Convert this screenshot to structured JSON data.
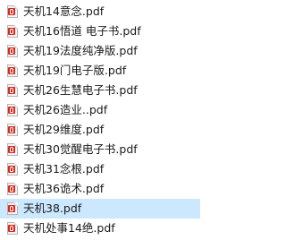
{
  "colors": {
    "selection": "#cce8ff",
    "pdf_badge": "#d42a1e",
    "text": "#1a1a1a"
  },
  "files": [
    {
      "name": "天机14意念.pdf",
      "icon": "pdf-icon",
      "selected": false
    },
    {
      "name": "天机16悟道 电子书.pdf",
      "icon": "pdf-icon",
      "selected": false
    },
    {
      "name": "天机19法度纯净版.pdf",
      "icon": "pdf-icon",
      "selected": false
    },
    {
      "name": "天机19门电子版.pdf",
      "icon": "pdf-icon",
      "selected": false
    },
    {
      "name": "天机26生慧电子书.pdf",
      "icon": "pdf-icon",
      "selected": false
    },
    {
      "name": "天机26造业..pdf",
      "icon": "pdf-icon",
      "selected": false
    },
    {
      "name": "天机29维度.pdf",
      "icon": "pdf-icon",
      "selected": false
    },
    {
      "name": "天机30觉醒电子书.pdf",
      "icon": "pdf-icon",
      "selected": false
    },
    {
      "name": "天机31念根.pdf",
      "icon": "pdf-icon",
      "selected": false
    },
    {
      "name": "天机36诡术.pdf",
      "icon": "pdf-icon",
      "selected": false
    },
    {
      "name": "天机38.pdf",
      "icon": "pdf-icon",
      "selected": true
    },
    {
      "name": "天机处事14绝.pdf",
      "icon": "pdf-icon",
      "selected": false
    }
  ]
}
